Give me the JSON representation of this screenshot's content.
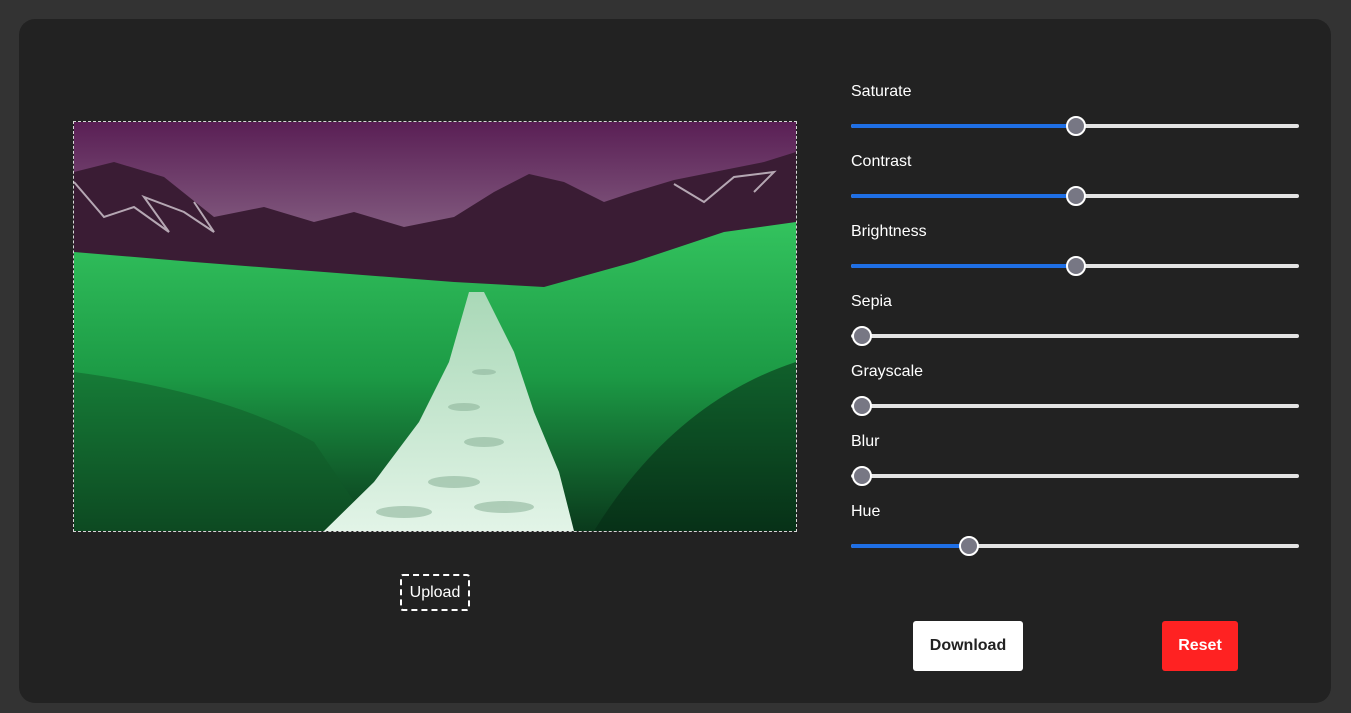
{
  "theme": {
    "page_bg": "#333333",
    "panel_bg": "#222222",
    "accent": "#1f6fe5",
    "track": "#e4e4e4",
    "thumb": "#777784",
    "reset_bg": "#ff2222"
  },
  "preview": {
    "description": "photo of a stone path through green grass toward purple-tinted mountains",
    "colors": {
      "sky_top": "#5a1f55",
      "sky_light": "#c7d2cb",
      "mountain": "#3a1c34",
      "grass_light": "#33c35e",
      "grass_dark": "#0a3a1c",
      "path": "#d8f0df"
    }
  },
  "upload": {
    "label": "Upload"
  },
  "filters": [
    {
      "key": "saturate",
      "label": "Saturate",
      "value": 50,
      "min": 0,
      "max": 100,
      "filled": true
    },
    {
      "key": "contrast",
      "label": "Contrast",
      "value": 50,
      "min": 0,
      "max": 100,
      "filled": true
    },
    {
      "key": "brightness",
      "label": "Brightness",
      "value": 50,
      "min": 0,
      "max": 100,
      "filled": true
    },
    {
      "key": "sepia",
      "label": "Sepia",
      "value": 0,
      "min": 0,
      "max": 100,
      "filled": false
    },
    {
      "key": "grayscale",
      "label": "Grayscale",
      "value": 0,
      "min": 0,
      "max": 100,
      "filled": false
    },
    {
      "key": "blur",
      "label": "Blur",
      "value": 0,
      "min": 0,
      "max": 100,
      "filled": false
    },
    {
      "key": "hue",
      "label": "Hue",
      "value": 25,
      "min": 0,
      "max": 100,
      "filled": true
    }
  ],
  "actions": {
    "download_label": "Download",
    "reset_label": "Reset"
  }
}
